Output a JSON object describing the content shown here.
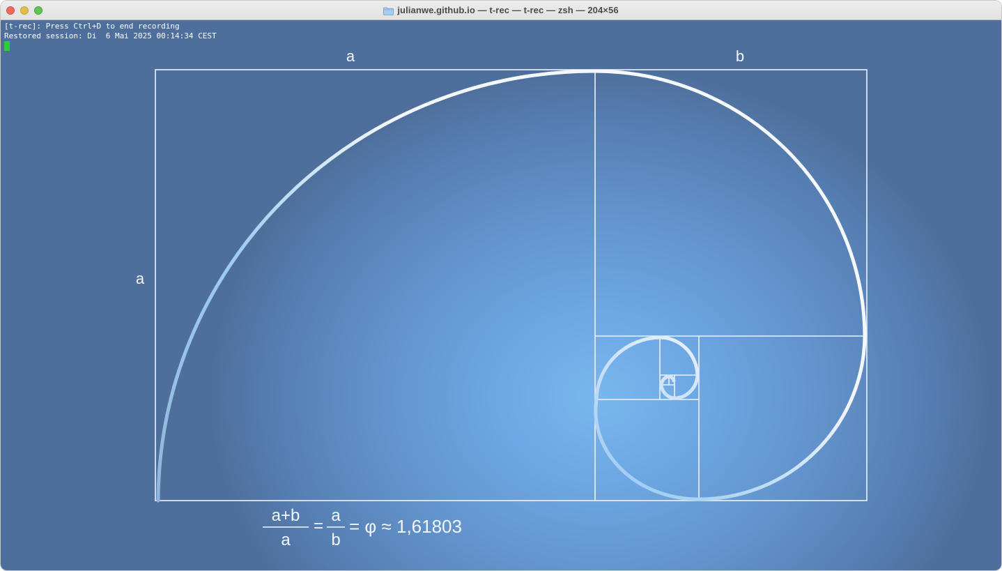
{
  "window": {
    "title": "julianwe.github.io — t-rec — t-rec — zsh — 204×56",
    "title_icon": "folder-icon"
  },
  "terminal": {
    "lines": [
      "[t-rec]: Press Ctrl+D to end recording",
      "Restored session: Di  6 Mai 2025 00:14:34 CEST"
    ],
    "cursor_color": "#2fcd3a"
  },
  "figure": {
    "top_label_left": "a",
    "top_label_right": "b",
    "side_label": "a",
    "formula": {
      "frac1_num": "a+b",
      "frac1_den": "a",
      "eq1": "=",
      "frac2_num": "a",
      "frac2_den": "b",
      "tail": "= φ ≈ 1,61803"
    }
  },
  "colors": {
    "background_center": "#7ab6ee",
    "background_edge": "#4e6f9c",
    "lines": "#eef3f9"
  }
}
